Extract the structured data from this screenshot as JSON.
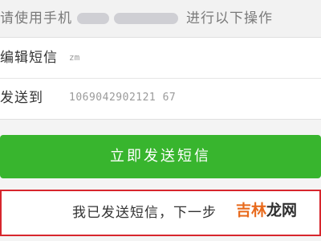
{
  "instruction": {
    "text_before": "请使用手机",
    "text_after": "进行以下操作"
  },
  "form": {
    "edit_label": "编辑短信",
    "edit_value": "zm",
    "send_to_label": "发送到",
    "send_to_value": "1069042902121 67"
  },
  "send_button": {
    "label": "立即发送短信"
  },
  "confirm": {
    "label": "我已发送短信，下一步"
  },
  "watermark": {
    "accent": "吉林",
    "rest": "龙网"
  },
  "colors": {
    "button_green": "#38b52e",
    "highlight_red": "#d7262d",
    "watermark_orange": "#e86a1c"
  }
}
